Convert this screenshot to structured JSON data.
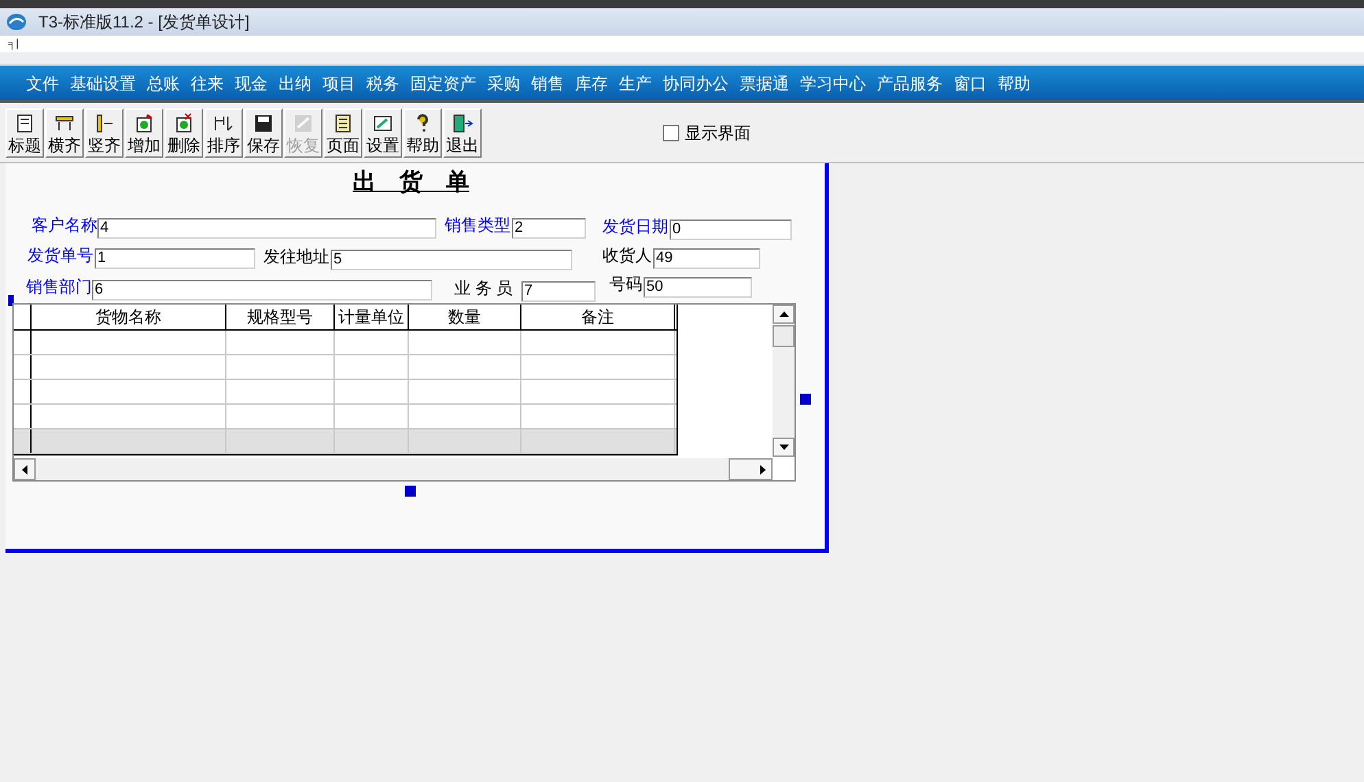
{
  "window": {
    "title": "T3-标准版11.2 - [发货单设计]",
    "menu_glyph": "╕|"
  },
  "menu": [
    "文件",
    "基础设置",
    "总账",
    "往来",
    "现金",
    "出纳",
    "项目",
    "税务",
    "固定资产",
    "采购",
    "销售",
    "库存",
    "生产",
    "协同办公",
    "票据通",
    "学习中心",
    "产品服务",
    "窗口",
    "帮助"
  ],
  "toolbar": [
    {
      "label": "标题",
      "disabled": false
    },
    {
      "label": "横齐",
      "disabled": false
    },
    {
      "label": "竖齐",
      "disabled": false
    },
    {
      "label": "增加",
      "disabled": false
    },
    {
      "label": "删除",
      "disabled": false
    },
    {
      "label": "排序",
      "disabled": false
    },
    {
      "label": "保存",
      "disabled": false
    },
    {
      "label": "恢复",
      "disabled": true
    },
    {
      "label": "页面",
      "disabled": false
    },
    {
      "label": "设置",
      "disabled": false
    },
    {
      "label": "帮助",
      "disabled": false
    },
    {
      "label": "退出",
      "disabled": false
    }
  ],
  "show_interface": {
    "label": "显示界面",
    "checked": false
  },
  "form": {
    "title": "出　货　单",
    "fields": [
      {
        "label": "客户名称",
        "value": "4",
        "color": "#0000ff"
      },
      {
        "label": "销售类型",
        "value": "2",
        "color": "#0000ff"
      },
      {
        "label": "发货日期",
        "value": "0",
        "color": "#0000ff"
      },
      {
        "label": "发货单号",
        "value": "1",
        "color": "#0000ff"
      },
      {
        "label": "发往地址",
        "value": "5",
        "color": "#000000"
      },
      {
        "label": "收货人",
        "value": "49",
        "color": "#000000"
      },
      {
        "label": "销售部门",
        "value": "6",
        "color": "#0000ff"
      },
      {
        "label": "业 务 员",
        "value": "7",
        "color": "#000000"
      },
      {
        "label": "号码",
        "value": "50",
        "color": "#000000"
      }
    ],
    "table": {
      "columns": [
        "货物名称",
        "规格型号",
        "计量单位",
        "数量",
        "备注"
      ]
    }
  }
}
